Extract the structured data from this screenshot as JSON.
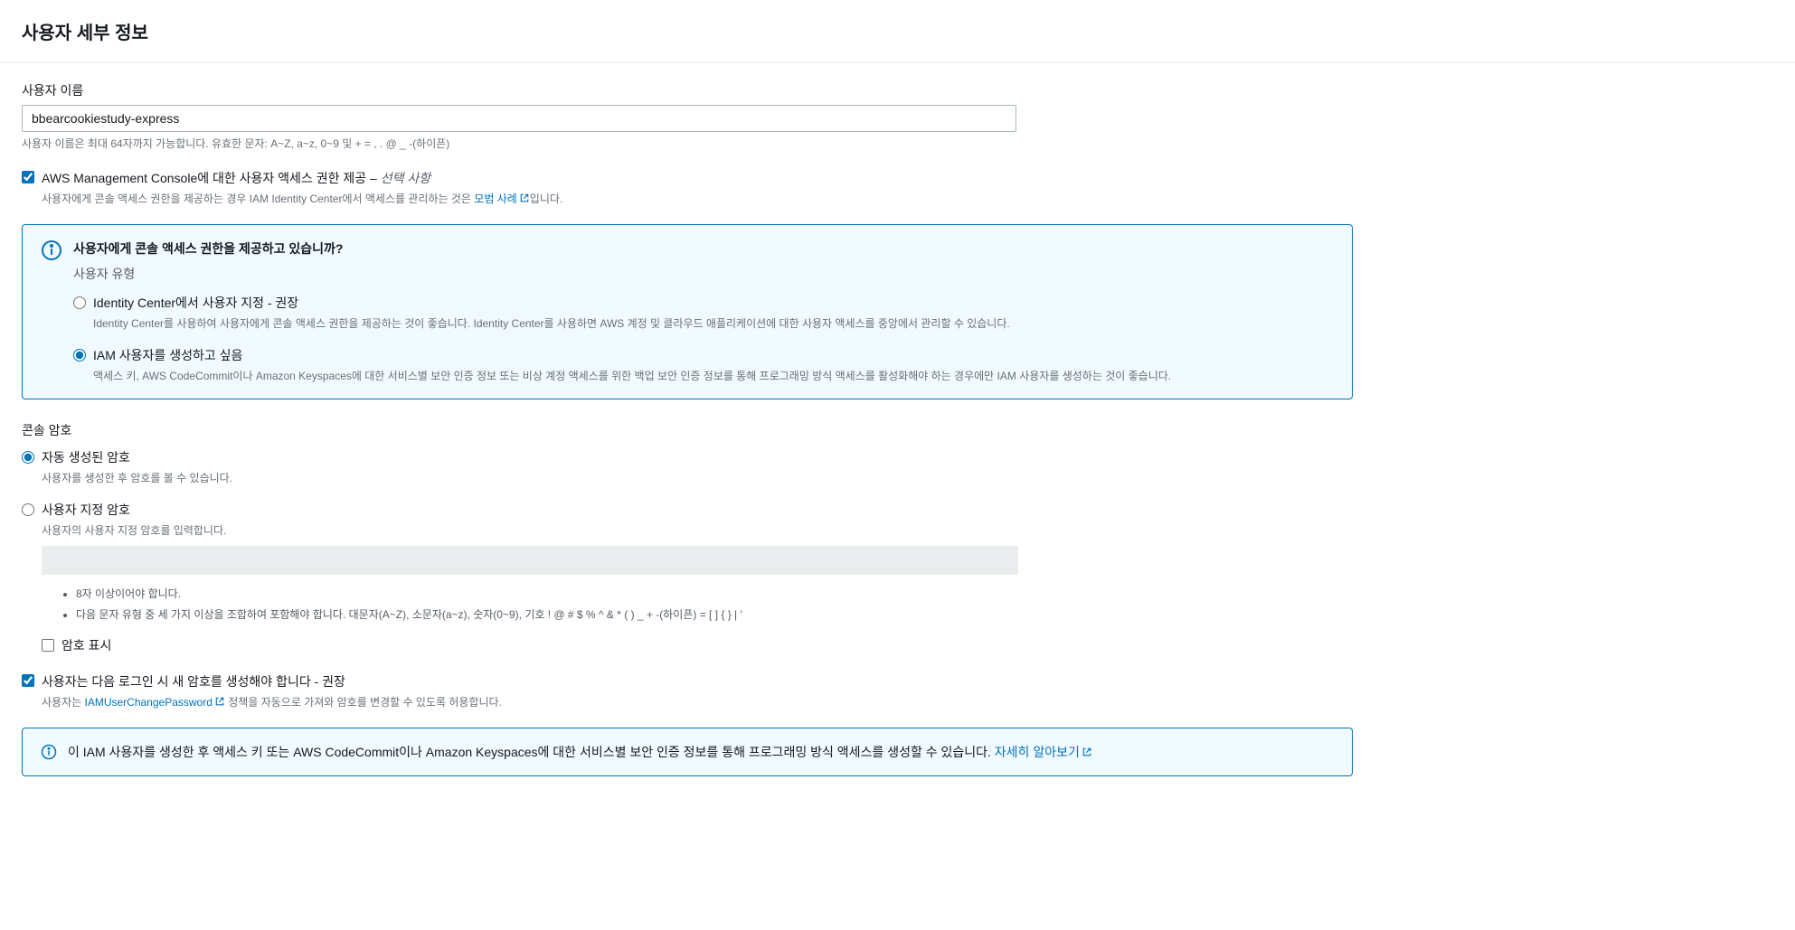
{
  "header": {
    "title": "사용자 세부 정보"
  },
  "username": {
    "label": "사용자 이름",
    "value": "bbearcookiestudy-express",
    "hint": "사용자 이름은 최대 64자까지 가능합니다. 유효한 문자: A~Z, a~z, 0~9 및 + = , . @ _ -(하이픈)"
  },
  "console_access": {
    "checkbox_label": "AWS Management Console에 대한 사용자 액세스 권한 제공 – ",
    "optional": "선택 사항",
    "hint_prefix": "사용자에게 콘솔 액세스 권한을 제공하는 경우 IAM Identity Center에서 액세스를 관리하는 것은 ",
    "hint_link": "모범 사례",
    "hint_suffix": "입니다.",
    "checked": true
  },
  "user_type_panel": {
    "title": "사용자에게 콘솔 액세스 권한을 제공하고 있습니까?",
    "subtitle": "사용자 유형",
    "option1": {
      "label": "Identity Center에서 사용자 지정 - 권장",
      "hint": "Identity Center를 사용하여 사용자에게 콘솔 액세스 권한을 제공하는 것이 좋습니다. Identity Center를 사용하면 AWS 계정 및 클라우드 애플리케이션에 대한 사용자 액세스를 중앙에서 관리할 수 있습니다.",
      "selected": false
    },
    "option2": {
      "label": "IAM 사용자를 생성하고 싶음",
      "hint": "액세스 키, AWS CodeCommit이나 Amazon Keyspaces에 대한 서비스별 보안 인증 정보 또는 비상 계정 액세스를 위한 백업 보안 인증 정보를 통해 프로그래밍 방식 액세스를 활성화해야 하는 경우에만 IAM 사용자를 생성하는 것이 좋습니다.",
      "selected": true
    }
  },
  "console_password": {
    "section_label": "콘솔 암호",
    "auto_option": {
      "label": "자동 생성된 암호",
      "hint": "사용자를 생성한 후 암호를 볼 수 있습니다.",
      "selected": true
    },
    "custom_option": {
      "label": "사용자 지정 암호",
      "hint": "사용자의 사용자 지정 암호를 입력합니다.",
      "selected": false
    },
    "rules": {
      "rule1": "8자 이상이어야 합니다.",
      "rule2": "다음 문자 유형 중 세 가지 이상을 조합하여 포함해야 합니다. 대문자(A~Z), 소문자(a~z), 숫자(0~9), 기호 ! @ # $ % ^ & * ( ) _ + -(하이픈) = [ ] { } | '"
    },
    "show_password": "암호 표시"
  },
  "must_change_password": {
    "label": "사용자는 다음 로그인 시 새 암호를 생성해야 합니다 - 권장",
    "hint_prefix": "사용자는 ",
    "hint_link": "IAMUserChangePassword",
    "hint_suffix": " 정책을 자동으로 가져와 암호를 변경할 수 있도록 허용합니다.",
    "checked": true
  },
  "bottom_info": {
    "text": "이 IAM 사용자를 생성한 후 액세스 키 또는 AWS CodeCommit이나 Amazon Keyspaces에 대한 서비스별 보안 인증 정보를 통해 프로그래밍 방식 액세스를 생성할 수 있습니다. ",
    "link": "자세히 알아보기"
  }
}
